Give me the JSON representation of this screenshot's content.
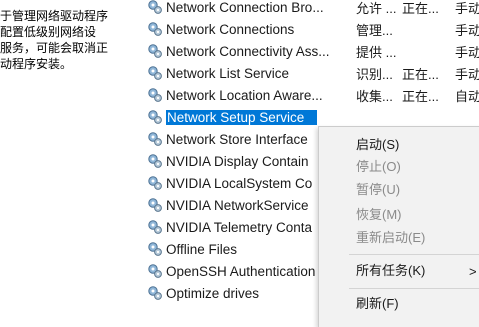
{
  "description": {
    "lines": [
      "于管理网络驱动程序",
      "配置低级别网络设",
      "服务，可能会取消正",
      "动程序安装。"
    ]
  },
  "services": [
    {
      "name": "Network Connection Bro...",
      "desc": "允许 ...",
      "status": "正在...",
      "startup": "手动"
    },
    {
      "name": "Network Connections",
      "desc": "管理...",
      "status": "",
      "startup": "手动"
    },
    {
      "name": "Network Connectivity Ass...",
      "desc": "提供 ...",
      "status": "",
      "startup": "手动"
    },
    {
      "name": "Network List Service",
      "desc": "识别...",
      "status": "正在...",
      "startup": "手动"
    },
    {
      "name": "Network Location Aware...",
      "desc": "收集...",
      "status": "正在...",
      "startup": "自动"
    },
    {
      "name": "Network Setup Service",
      "desc": "",
      "status": "",
      "startup": ""
    },
    {
      "name": "Network Store Interface",
      "desc": "",
      "status": "",
      "startup": ""
    },
    {
      "name": "NVIDIA Display Contain",
      "desc": "",
      "status": "",
      "startup": ""
    },
    {
      "name": "NVIDIA LocalSystem Co",
      "desc": "",
      "status": "",
      "startup": ""
    },
    {
      "name": "NVIDIA NetworkService",
      "desc": "",
      "status": "",
      "startup": ""
    },
    {
      "name": "NVIDIA Telemetry Conta",
      "desc": "",
      "status": "",
      "startup": ""
    },
    {
      "name": "Offline Files",
      "desc": "",
      "status": "",
      "startup": ""
    },
    {
      "name": "OpenSSH Authentication",
      "desc": "",
      "status": "",
      "startup": ""
    },
    {
      "name": "Optimize drives",
      "desc": "",
      "status": "",
      "startup": ""
    }
  ],
  "context_menu": {
    "start": "启动(S)",
    "stop": "停止(O)",
    "pause": "暂停(U)",
    "resume": "恢复(M)",
    "restart": "重新启动(E)",
    "all_tasks": "所有任务(K)",
    "submenu_arrow": ">",
    "refresh": "刷新(F)"
  },
  "colors": {
    "selection": "#0078d7",
    "menu_bg": "#f2f2f2",
    "disabled_text": "#8a8a8a"
  },
  "icons": {
    "service": "gear-icon"
  }
}
